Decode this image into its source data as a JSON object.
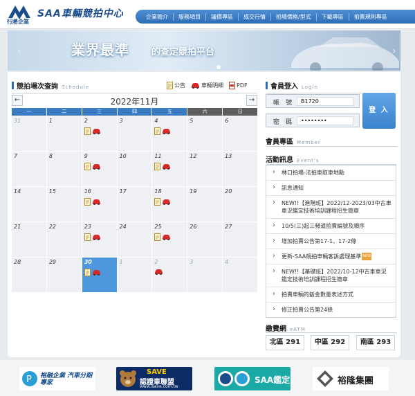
{
  "header": {
    "site_title": "SAA車輛競拍中心",
    "logo_text": "行將企業",
    "nav": [
      "企業簡介",
      "服務項目",
      "議價專區",
      "成交行情",
      "拍場價格/型式",
      "下載專區",
      "拍賣規則專區"
    ],
    "brand_color": "#2d6db7"
  },
  "banner": {
    "slogan": "業界最準",
    "sub": "的查定競拍平台",
    "prev_icon": "‹",
    "next_icon": "›"
  },
  "schedule": {
    "title": "競拍場次查詢",
    "title_en": "Schedule",
    "legend": {
      "notice": "公告",
      "vehicle": "車輛明細",
      "pdf": "PDF"
    },
    "month_label": "2022年11月",
    "prev_icon": "←",
    "next_icon": "→",
    "weekdays": [
      "一",
      "二",
      "三",
      "四",
      "五",
      "六",
      "日"
    ],
    "days": [
      {
        "n": "31",
        "other": true,
        "icons": []
      },
      {
        "n": "1",
        "icons": []
      },
      {
        "n": "2",
        "icons": [
          "doc",
          "car"
        ]
      },
      {
        "n": "3",
        "icons": []
      },
      {
        "n": "4",
        "icons": [
          "doc",
          "car"
        ]
      },
      {
        "n": "5",
        "icons": []
      },
      {
        "n": "6",
        "icons": []
      },
      {
        "n": "7",
        "icons": []
      },
      {
        "n": "8",
        "icons": []
      },
      {
        "n": "9",
        "icons": [
          "doc",
          "car"
        ]
      },
      {
        "n": "10",
        "icons": []
      },
      {
        "n": "11",
        "icons": [
          "doc",
          "car"
        ]
      },
      {
        "n": "12",
        "icons": []
      },
      {
        "n": "13",
        "icons": []
      },
      {
        "n": "14",
        "icons": []
      },
      {
        "n": "15",
        "icons": []
      },
      {
        "n": "16",
        "icons": [
          "doc",
          "car"
        ]
      },
      {
        "n": "17",
        "icons": []
      },
      {
        "n": "18",
        "icons": [
          "doc",
          "car"
        ]
      },
      {
        "n": "19",
        "icons": []
      },
      {
        "n": "20",
        "icons": []
      },
      {
        "n": "21",
        "icons": []
      },
      {
        "n": "22",
        "icons": []
      },
      {
        "n": "23",
        "icons": [
          "doc",
          "car"
        ]
      },
      {
        "n": "24",
        "icons": []
      },
      {
        "n": "25",
        "icons": [
          "doc",
          "car"
        ]
      },
      {
        "n": "26",
        "icons": []
      },
      {
        "n": "27",
        "icons": []
      },
      {
        "n": "28",
        "icons": []
      },
      {
        "n": "29",
        "icons": []
      },
      {
        "n": "30",
        "today": true,
        "icons": [
          "doc",
          "car"
        ]
      },
      {
        "n": "1",
        "other": true,
        "icons": []
      },
      {
        "n": "2",
        "other": true,
        "icons": [
          "car"
        ]
      },
      {
        "n": "3",
        "other": true,
        "icons": []
      },
      {
        "n": "4",
        "other": true,
        "icons": []
      }
    ]
  },
  "login": {
    "title": "會員登入",
    "title_en": "Login",
    "account_label": "帳　號",
    "account_value": "B1720",
    "password_label": "密　碼",
    "password_value": "••••••••",
    "button": "登 入"
  },
  "member": {
    "title": "會員專區",
    "title_en": "Member"
  },
  "events": {
    "title": "活動訊息",
    "title_en": "Event's",
    "items": [
      {
        "text": "林口拍場-法拍車取車地點",
        "new": false
      },
      {
        "text": "訊息通知",
        "new": false
      },
      {
        "text": "NEW!!【進階班】2022/12-2023/03中古車車況鑑定技術培訓課程招生簡章",
        "new": false
      },
      {
        "text": "10/5(三)起三頻道拍賣編號及順序",
        "new": false
      },
      {
        "text": "增加拍賣公告第17-1、17-2條",
        "new": false
      },
      {
        "text": "更新-SAA競拍車輛客訴處理基準",
        "new": true
      },
      {
        "text": "NEW!!【基礎班】2022/10-12中古車車況鑑定技術培訓課程招生簡章",
        "new": false
      },
      {
        "text": "拍賣車輛的鈑金數量表述方式",
        "new": false
      },
      {
        "text": "修正拍賣公告第24條",
        "new": false
      }
    ],
    "new_badge": "NEW"
  },
  "atm": {
    "title": "繳費網",
    "title_en": "eATM",
    "north": "北區 291",
    "central": "中區 292",
    "south": "南區 293"
  },
  "partners": {
    "p1": "裕融企業 汽車分期專家",
    "p2_top": "SAVE",
    "p2_main": "認證車聯盟",
    "p2_url": "www.isave.com.tw",
    "p3": "SAA鑑定",
    "p4": "裕隆集團"
  }
}
